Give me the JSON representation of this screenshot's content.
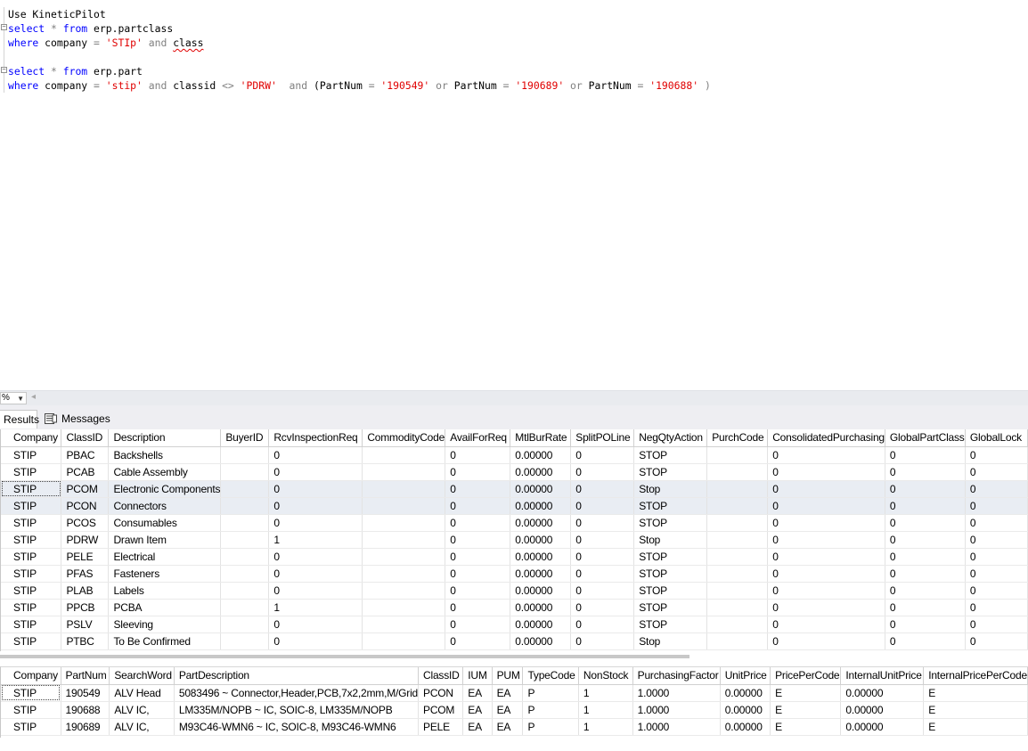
{
  "editor": {
    "lines": [
      {
        "tokens": [
          {
            "t": "Use KineticPilot",
            "c": "plain"
          }
        ]
      },
      {
        "tokens": [
          {
            "t": "select",
            "c": "kw"
          },
          {
            "t": " * ",
            "c": "op"
          },
          {
            "t": "from",
            "c": "kw"
          },
          {
            "t": " erp.partclass",
            "c": "plain"
          }
        ]
      },
      {
        "tokens": [
          {
            "t": "where",
            "c": "kw"
          },
          {
            "t": " company ",
            "c": "plain"
          },
          {
            "t": "=",
            "c": "op"
          },
          {
            "t": " ",
            "c": "plain"
          },
          {
            "t": "'STIp'",
            "c": "str"
          },
          {
            "t": " ",
            "c": "plain"
          },
          {
            "t": "and",
            "c": "op"
          },
          {
            "t": " ",
            "c": "plain"
          },
          {
            "t": "class",
            "c": "squiggle"
          }
        ]
      },
      {
        "tokens": []
      },
      {
        "tokens": [
          {
            "t": "select",
            "c": "kw"
          },
          {
            "t": " * ",
            "c": "op"
          },
          {
            "t": "from",
            "c": "kw"
          },
          {
            "t": " erp.part",
            "c": "plain"
          }
        ]
      },
      {
        "tokens": [
          {
            "t": "where",
            "c": "kw"
          },
          {
            "t": " company ",
            "c": "plain"
          },
          {
            "t": "=",
            "c": "op"
          },
          {
            "t": " ",
            "c": "plain"
          },
          {
            "t": "'stip'",
            "c": "str"
          },
          {
            "t": " ",
            "c": "plain"
          },
          {
            "t": "and",
            "c": "op"
          },
          {
            "t": " classid ",
            "c": "plain"
          },
          {
            "t": "<>",
            "c": "op"
          },
          {
            "t": " ",
            "c": "plain"
          },
          {
            "t": "'PDRW'",
            "c": "str"
          },
          {
            "t": "  ",
            "c": "plain"
          },
          {
            "t": "and",
            "c": "op"
          },
          {
            "t": " (PartNum ",
            "c": "plain"
          },
          {
            "t": "=",
            "c": "op"
          },
          {
            "t": " ",
            "c": "plain"
          },
          {
            "t": "'190549'",
            "c": "str"
          },
          {
            "t": " ",
            "c": "plain"
          },
          {
            "t": "or",
            "c": "op"
          },
          {
            "t": " PartNum ",
            "c": "plain"
          },
          {
            "t": "=",
            "c": "op"
          },
          {
            "t": " ",
            "c": "plain"
          },
          {
            "t": "'190689'",
            "c": "str"
          },
          {
            "t": " ",
            "c": "plain"
          },
          {
            "t": "or",
            "c": "op"
          },
          {
            "t": " PartNum ",
            "c": "plain"
          },
          {
            "t": "=",
            "c": "op"
          },
          {
            "t": " ",
            "c": "plain"
          },
          {
            "t": "'190688'",
            "c": "str"
          },
          {
            "t": " )",
            "c": "op"
          }
        ]
      }
    ]
  },
  "zoom": {
    "value": "%",
    "arrow_icon": "chevron-down-icon"
  },
  "tabs": {
    "results": "Results",
    "messages": "Messages",
    "messages_icon": "messages-icon"
  },
  "grid1": {
    "columns": [
      "Company",
      "ClassID",
      "Description",
      "BuyerID",
      "RcvInspectionReq",
      "CommodityCode",
      "AvailForReq",
      "MtlBurRate",
      "SplitPOLine",
      "NegQtyAction",
      "PurchCode",
      "ConsolidatedPurchasing",
      "GlobalPartClass",
      "GlobalLock"
    ],
    "rows": [
      [
        "STIP",
        "PBAC",
        "Backshells",
        "",
        "0",
        "",
        "0",
        "0.00000",
        "0",
        "STOP",
        "",
        "0",
        "0",
        "0"
      ],
      [
        "STIP",
        "PCAB",
        "Cable Assembly",
        "",
        "0",
        "",
        "0",
        "0.00000",
        "0",
        "STOP",
        "",
        "0",
        "0",
        "0"
      ],
      [
        "STIP",
        "PCOM",
        "Electronic Components",
        "",
        "0",
        "",
        "0",
        "0.00000",
        "0",
        "Stop",
        "",
        "0",
        "0",
        "0"
      ],
      [
        "STIP",
        "PCON",
        "Connectors",
        "",
        "0",
        "",
        "0",
        "0.00000",
        "0",
        "STOP",
        "",
        "0",
        "0",
        "0"
      ],
      [
        "STIP",
        "PCOS",
        "Consumables",
        "",
        "0",
        "",
        "0",
        "0.00000",
        "0",
        "STOP",
        "",
        "0",
        "0",
        "0"
      ],
      [
        "STIP",
        "PDRW",
        "Drawn Item",
        "",
        "1",
        "",
        "0",
        "0.00000",
        "0",
        "Stop",
        "",
        "0",
        "0",
        "0"
      ],
      [
        "STIP",
        "PELE",
        "Electrical",
        "",
        "0",
        "",
        "0",
        "0.00000",
        "0",
        "STOP",
        "",
        "0",
        "0",
        "0"
      ],
      [
        "STIP",
        "PFAS",
        "Fasteners",
        "",
        "0",
        "",
        "0",
        "0.00000",
        "0",
        "STOP",
        "",
        "0",
        "0",
        "0"
      ],
      [
        "STIP",
        "PLAB",
        "Labels",
        "",
        "0",
        "",
        "0",
        "0.00000",
        "0",
        "STOP",
        "",
        "0",
        "0",
        "0"
      ],
      [
        "STIP",
        "PPCB",
        "PCBA",
        "",
        "1",
        "",
        "0",
        "0.00000",
        "0",
        "STOP",
        "",
        "0",
        "0",
        "0"
      ],
      [
        "STIP",
        "PSLV",
        "Sleeving",
        "",
        "0",
        "",
        "0",
        "0.00000",
        "0",
        "STOP",
        "",
        "0",
        "0",
        "0"
      ],
      [
        "STIP",
        "PTBC",
        "To Be Confirmed",
        "",
        "0",
        "",
        "0",
        "0.00000",
        "0",
        "Stop",
        "",
        "0",
        "0",
        "0"
      ]
    ],
    "selected_rows": [
      2,
      3
    ],
    "focused_cell": [
      2,
      0
    ]
  },
  "grid2": {
    "columns": [
      "Company",
      "PartNum",
      "SearchWord",
      "PartDescription",
      "ClassID",
      "IUM",
      "PUM",
      "TypeCode",
      "NonStock",
      "PurchasingFactor",
      "UnitPrice",
      "PricePerCode",
      "InternalUnitPrice",
      "InternalPricePerCode"
    ],
    "rows": [
      [
        "STIP",
        "190549",
        "ALV Head",
        "5083496 ~ Connector,Header,PCB,7x2,2mm,M/Grid",
        "PCON",
        "EA",
        "EA",
        "P",
        "1",
        "1.0000",
        "0.00000",
        "E",
        "0.00000",
        "E"
      ],
      [
        "STIP",
        "190688",
        "ALV IC,",
        "LM335M/NOPB ~ IC, SOIC-8, LM335M/NOPB",
        "PCOM",
        "EA",
        "EA",
        "P",
        "1",
        "1.0000",
        "0.00000",
        "E",
        "0.00000",
        "E"
      ],
      [
        "STIP",
        "190689",
        "ALV IC,",
        "M93C46-WMN6 ~ IC, SOIC-8, M93C46-WMN6",
        "PELE",
        "EA",
        "EA",
        "P",
        "1",
        "1.0000",
        "0.00000",
        "E",
        "0.00000",
        "E"
      ]
    ],
    "focused_cell": [
      0,
      0
    ]
  },
  "colors": {
    "keyword": "#0000ff",
    "string": "#e00000",
    "operator": "#808080",
    "selected_row": "#e9edf3"
  }
}
